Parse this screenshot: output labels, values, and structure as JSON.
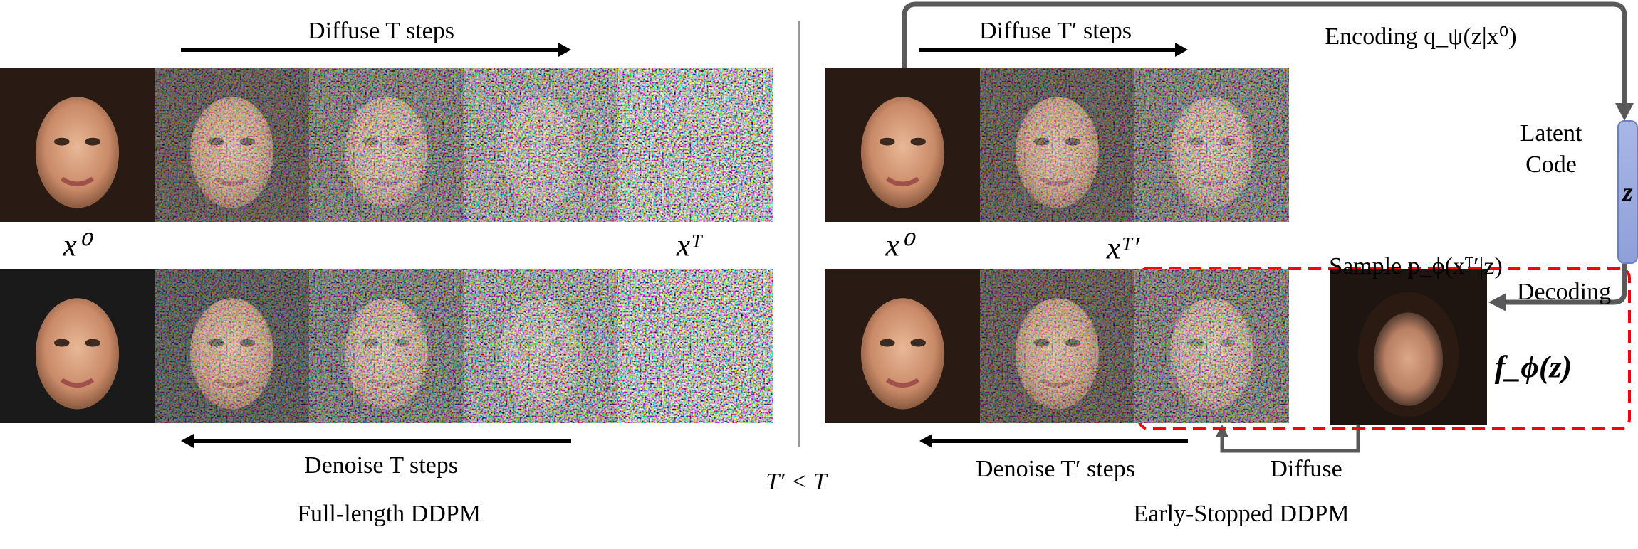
{
  "left_panel": {
    "diffuse_label": "Diffuse T steps",
    "denoise_label": "Denoise T steps",
    "x0_label": "x⁰",
    "xT_label": "xᵀ",
    "caption": "Full-length DDPM",
    "rows": [
      {
        "noise_levels": [
          0,
          0.45,
          0.65,
          0.85,
          1.0
        ],
        "hair": "#2a1a14"
      },
      {
        "noise_levels": [
          0,
          0.45,
          0.65,
          0.85,
          1.0
        ],
        "hair": "#1a1a1a"
      }
    ]
  },
  "middle": {
    "comparison": "T′ < T"
  },
  "right_panel": {
    "diffuse_label": "Diffuse T′ steps",
    "denoise_label": "Denoise T′ steps",
    "x0_label": "x⁰",
    "xT_label": "xᵀ′",
    "encoding_label": "Encoding q_ψ(z|x⁰)",
    "latent_label_1": "Latent",
    "latent_label_2": "Code",
    "z_label": "z",
    "sample_label": "Sample  p_ϕ(xᵀ′|z)",
    "decoding_label": "Decoding",
    "decoder_output_label": "f_ϕ(z)",
    "diffuse_small_label": "Diffuse",
    "caption": "Early-Stopped DDPM",
    "rows": [
      {
        "noise_levels": [
          0,
          0.45,
          0.65
        ]
      },
      {
        "noise_levels": [
          0,
          0.45,
          0.65
        ]
      }
    ]
  },
  "colors": {
    "flow_arrow": "#595959",
    "dashed_box": "#ff0000",
    "latent_box": "#a9b7e6"
  }
}
